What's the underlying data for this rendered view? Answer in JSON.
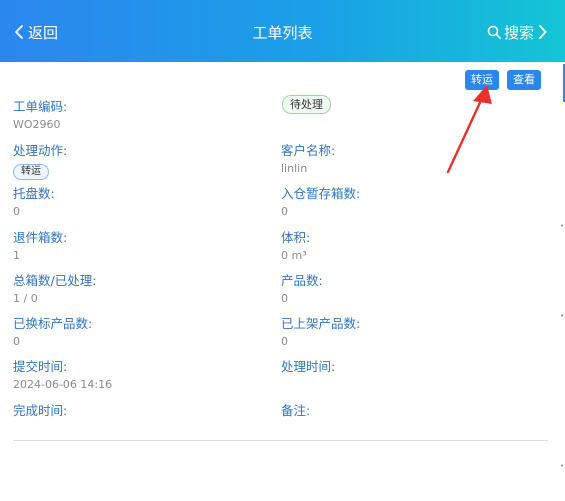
{
  "header": {
    "back_label": "返回",
    "title": "工单列表",
    "search_label": "搜索"
  },
  "card": {
    "transfer_button": "转运",
    "view_button": "查看",
    "status": "待处理",
    "fields": {
      "order_no": {
        "label": "工单编码:",
        "value": "WO2960"
      },
      "action": {
        "label": "处理动作:",
        "value": "转运"
      },
      "customer": {
        "label": "客户名称:",
        "value": "linlin"
      },
      "pallets": {
        "label": "托盘数:",
        "value": "0"
      },
      "temp_boxes": {
        "label": "入仓暂存箱数:",
        "value": "0"
      },
      "return_boxes": {
        "label": "退件箱数:",
        "value": "1"
      },
      "volume": {
        "label": "体积:",
        "value": "0  m³"
      },
      "total_boxes": {
        "label": "总箱数/已处理:",
        "value": "1 / 0"
      },
      "products": {
        "label": "产品数:",
        "value": "0"
      },
      "relabeled": {
        "label": "已换标产品数:",
        "value": "0"
      },
      "shelved": {
        "label": "已上架产品数:",
        "value": "0"
      },
      "submit_time": {
        "label": "提交时间:",
        "value": "2024-06-06 14:16"
      },
      "process_time": {
        "label": "处理时间:",
        "value": ""
      },
      "complete_time": {
        "label": "完成时间:",
        "value": ""
      },
      "remark": {
        "label": "备注:",
        "value": ""
      }
    }
  },
  "colors": {
    "header_start": "#2b86ee",
    "header_end": "#13c5d4",
    "button_blue": "#2d86ea",
    "label_blue": "#2f74c8",
    "annotation_arrow": "#e8312a"
  }
}
